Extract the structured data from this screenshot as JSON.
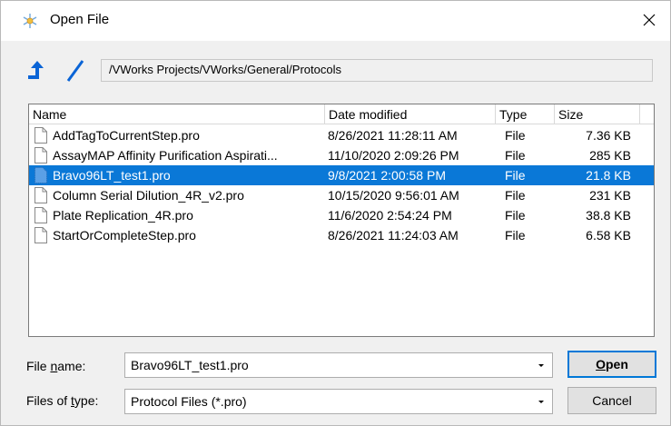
{
  "window": {
    "title": "Open File",
    "icon": "snowflake-icon",
    "close_icon": "close-icon"
  },
  "toolbar": {
    "up_icon": "up-arrow-icon",
    "separator_icon": "slash-icon",
    "path": "/VWorks Projects/VWorks/General/Protocols"
  },
  "list": {
    "columns": [
      "Name",
      "Date modified",
      "Type",
      "Size"
    ],
    "rows": [
      {
        "name": "AddTagToCurrentStep.pro",
        "date": "8/26/2021 11:28:11 AM",
        "type": "File",
        "size": "7.36 KB",
        "selected": false
      },
      {
        "name": "AssayMAP Affinity Purification Aspirati...",
        "date": "11/10/2020 2:09:26 PM",
        "type": "File",
        "size": "285 KB",
        "selected": false
      },
      {
        "name": "Bravo96LT_test1.pro",
        "date": "9/8/2021 2:00:58 PM",
        "type": "File",
        "size": "21.8 KB",
        "selected": true
      },
      {
        "name": "Column Serial Dilution_4R_v2.pro",
        "date": "10/15/2020 9:56:01 AM",
        "type": "File",
        "size": "231 KB",
        "selected": false
      },
      {
        "name": "Plate Replication_4R.pro",
        "date": "11/6/2020 2:54:24 PM",
        "type": "File",
        "size": "38.8 KB",
        "selected": false
      },
      {
        "name": "StartOrCompleteStep.pro",
        "date": "8/26/2021 11:24:03 AM",
        "type": "File",
        "size": "6.58 KB",
        "selected": false
      }
    ]
  },
  "filename": {
    "label_prefix": "File ",
    "label_underlined": "n",
    "label_suffix": "ame:",
    "value": "Bravo96LT_test1.pro"
  },
  "filetype": {
    "label_prefix": "Files of ",
    "label_underlined": "t",
    "label_suffix": "ype:",
    "value": "Protocol Files (*.pro)"
  },
  "buttons": {
    "open_underlined": "O",
    "open_rest": "pen",
    "cancel": "Cancel"
  },
  "colors": {
    "selection": "#0a78d7",
    "accent": "#0078d7"
  }
}
